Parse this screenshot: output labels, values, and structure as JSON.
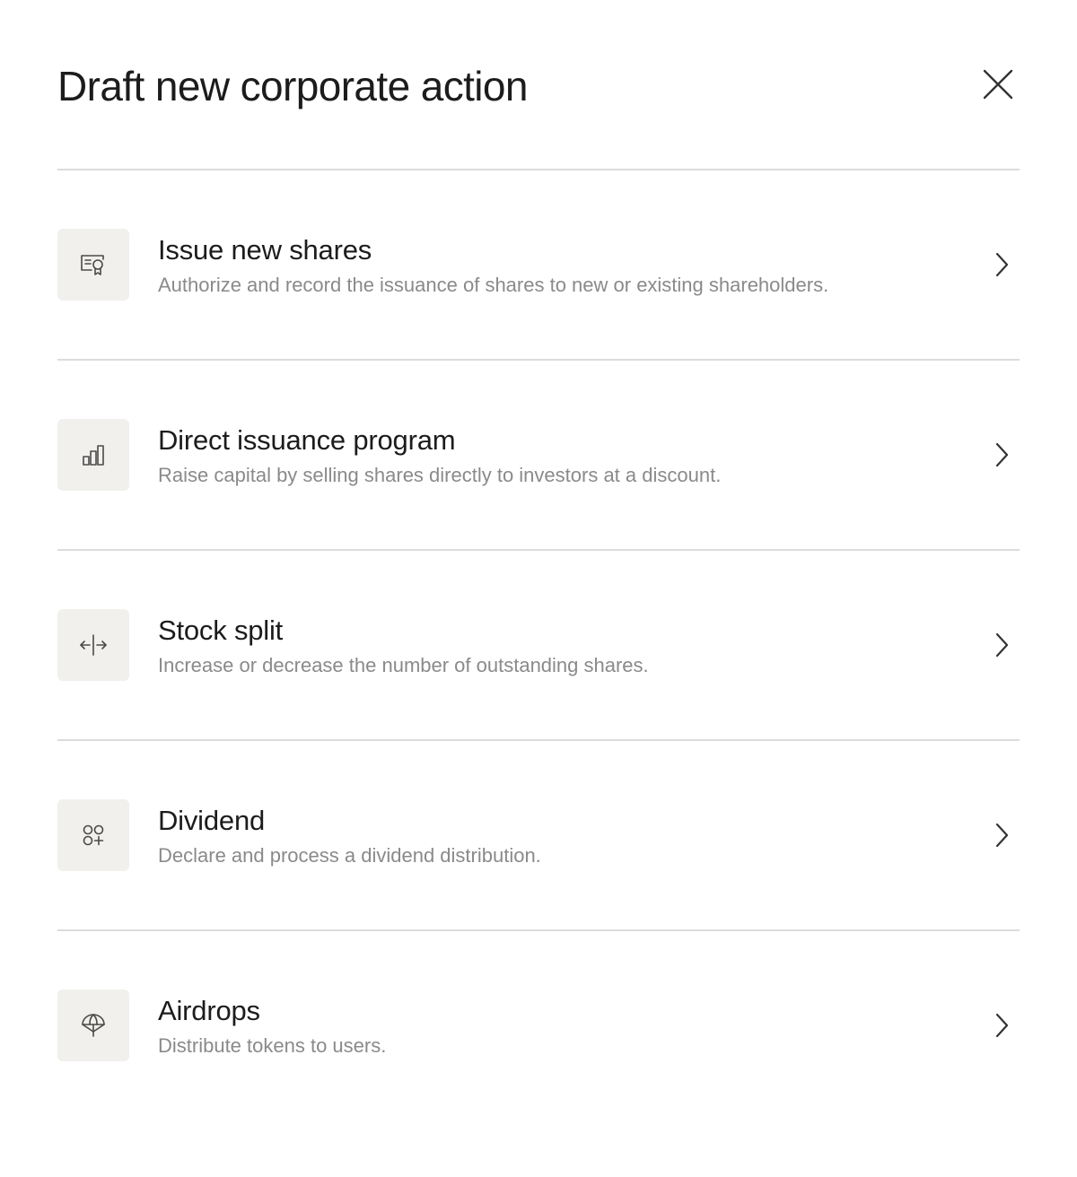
{
  "dialog": {
    "title": "Draft new corporate action",
    "close_icon": "close-icon"
  },
  "actions": [
    {
      "title": "Issue new shares",
      "description": "Authorize and record the issuance of shares to new or existing shareholders.",
      "icon": "certificate-icon"
    },
    {
      "title": "Direct issuance program",
      "description": "Raise capital by selling shares directly to investors at a discount.",
      "icon": "bar-chart-icon"
    },
    {
      "title": "Stock split",
      "description": "Increase or decrease the number of outstanding shares.",
      "icon": "split-arrows-icon"
    },
    {
      "title": "Dividend",
      "description": "Declare and process a dividend distribution.",
      "icon": "circles-plus-icon"
    },
    {
      "title": "Airdrops",
      "description": "Distribute tokens to users.",
      "icon": "parachute-icon"
    }
  ],
  "colors": {
    "tile_background": "#f1f0ed",
    "divider": "#dcdcdc",
    "title_text": "#1c1c1c",
    "description_text": "#8a8a8a",
    "icon_stroke": "#4a4a4a"
  }
}
